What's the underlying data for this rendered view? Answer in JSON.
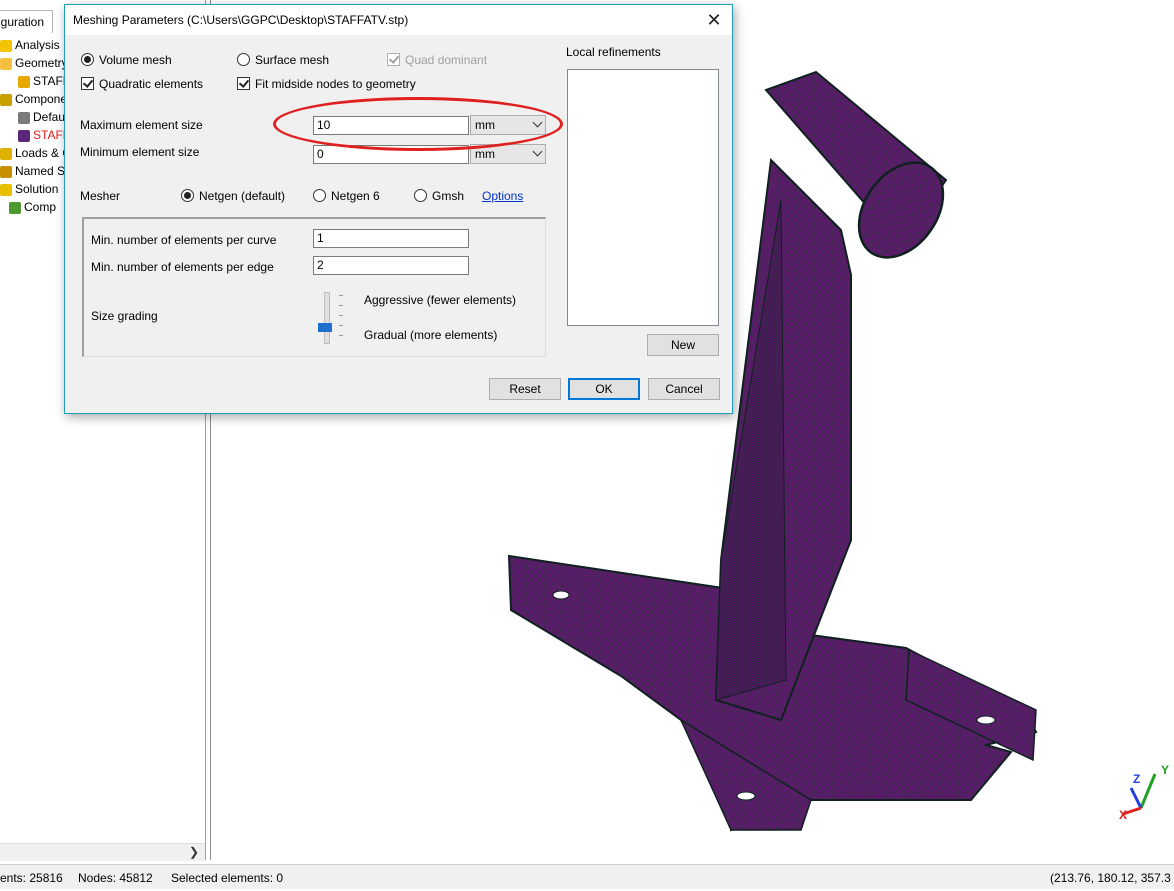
{
  "tree": {
    "tab_label": "iguration",
    "items": [
      {
        "label": "Analysis",
        "indent": 0,
        "icon_color": "#f3c400"
      },
      {
        "label": "Geometry",
        "indent": 0,
        "icon_color": "#f5c040"
      },
      {
        "label": "STAFF",
        "indent": 2,
        "icon_color": "#e6a800"
      },
      {
        "label": "Compone",
        "indent": 0,
        "icon_color": "#c8a000"
      },
      {
        "label": "Defau",
        "indent": 2,
        "icon_color": "#7a7a7a"
      },
      {
        "label": "STAFF",
        "indent": 2,
        "icon_color": "#5a2a7a",
        "red": true
      },
      {
        "label": "Loads & C",
        "indent": 0,
        "icon_color": "#e0b000"
      },
      {
        "label": "Named Se",
        "indent": 0,
        "icon_color": "#c89000"
      },
      {
        "label": "Solution",
        "indent": 0,
        "icon_color": "#e8c000"
      },
      {
        "label": "Comp",
        "indent": 1,
        "icon_color": "#4a9a30"
      }
    ]
  },
  "status": {
    "elements": "ents: 25816",
    "nodes": "Nodes: 45812",
    "selected": "Selected elements: 0",
    "coords": "(213.76, 180.12, 357.3"
  },
  "dialog": {
    "title": "Meshing Parameters (C:\\Users\\GGPC\\Desktop\\STAFFATV.stp)",
    "volume_mesh": "Volume mesh",
    "surface_mesh": "Surface mesh",
    "quad_dominant": "Quad dominant",
    "quadratic_elements": "Quadratic elements",
    "fit_midside": "Fit midside nodes to geometry",
    "max_size_label": "Maximum element size",
    "max_size_value": "10",
    "max_size_unit": "mm",
    "min_size_label": "Minimum element size",
    "min_size_value": "0",
    "min_size_unit": "mm",
    "mesher_label": "Mesher",
    "mesher_netgen": "Netgen (default)",
    "mesher_netgen6": "Netgen 6",
    "mesher_gmsh": "Gmsh",
    "options_link": "Options",
    "min_per_curve_label": "Min. number of elements per curve",
    "min_per_curve_value": "1",
    "min_per_edge_label": "Min. number of elements per edge",
    "min_per_edge_value": "2",
    "size_grading_label": "Size grading",
    "grading_aggressive": "Aggressive (fewer elements)",
    "grading_gradual": "Gradual (more elements)",
    "size_grading_level": 0.25,
    "local_refinements_label": "Local refinements",
    "new_button": "New",
    "reset_button": "Reset",
    "ok_button": "OK",
    "cancel_button": "Cancel"
  },
  "axes_triad": {
    "x": "X",
    "y": "Y",
    "z": "Z"
  },
  "colors": {
    "mesh": "#5b1a6b",
    "mesh_lines": "#1a3a2a",
    "dialog_border": "#1d9fb6",
    "highlight_ellipse": "#e02020"
  }
}
